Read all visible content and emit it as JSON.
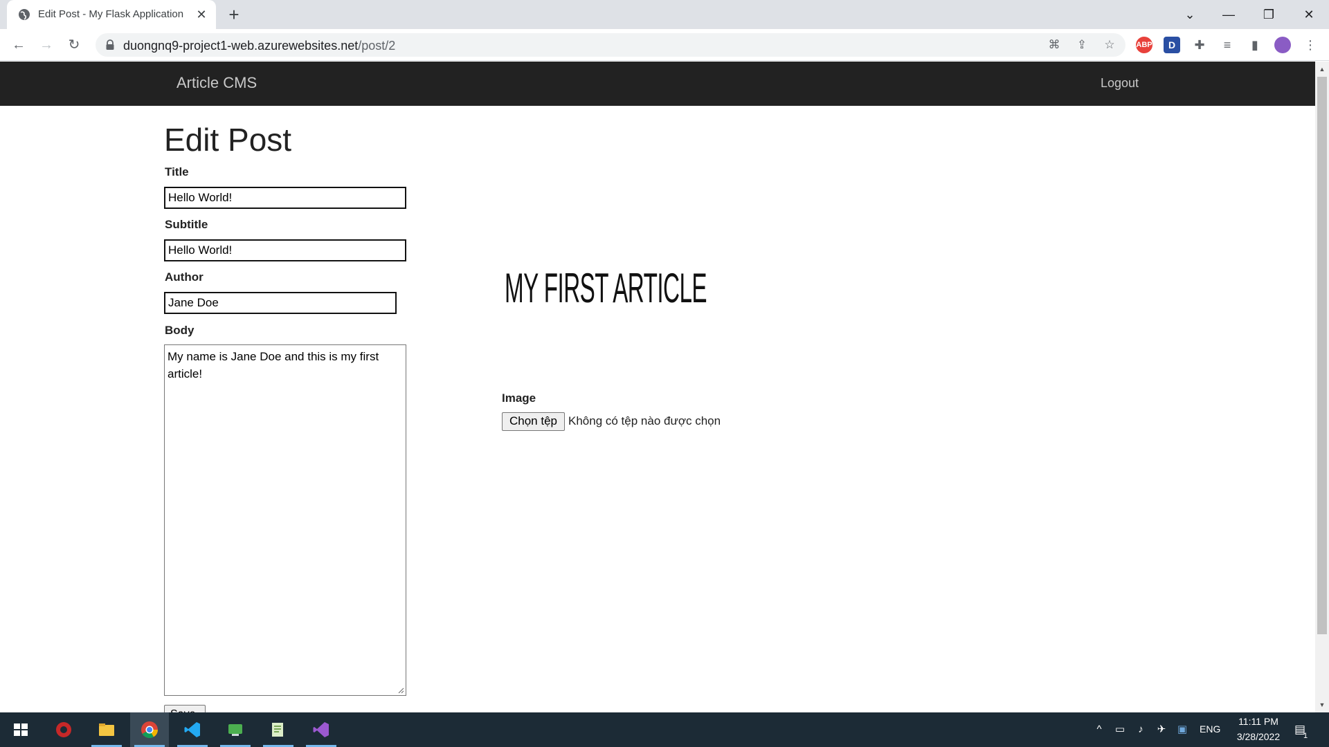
{
  "browser": {
    "tab_title": "Edit Post - My Flask Application",
    "tab_close": "✕",
    "new_tab": "+",
    "url_host": "duongnq9-project1-web.azurewebsites.net",
    "url_path": "/post/2",
    "ext_abp": "ABP",
    "ext_d": "D"
  },
  "nav": {
    "brand": "Article CMS",
    "logout": "Logout"
  },
  "form": {
    "heading": "Edit Post",
    "title_label": "Title",
    "title_value": "Hello World!",
    "subtitle_label": "Subtitle",
    "subtitle_value": "Hello World!",
    "author_label": "Author",
    "author_value": "Jane Doe",
    "body_label": "Body",
    "body_value": "My name is Jane Doe and this is my first article!",
    "submit_label": "Save",
    "image_label": "Image",
    "image_text": "MY FIRST ARTICLE",
    "file_button": "Chọn tệp",
    "file_status": "Không có tệp nào được chọn"
  },
  "taskbar": {
    "language": "ENG",
    "time": "11:11 PM",
    "date": "3/28/2022",
    "notification_count": "1"
  }
}
